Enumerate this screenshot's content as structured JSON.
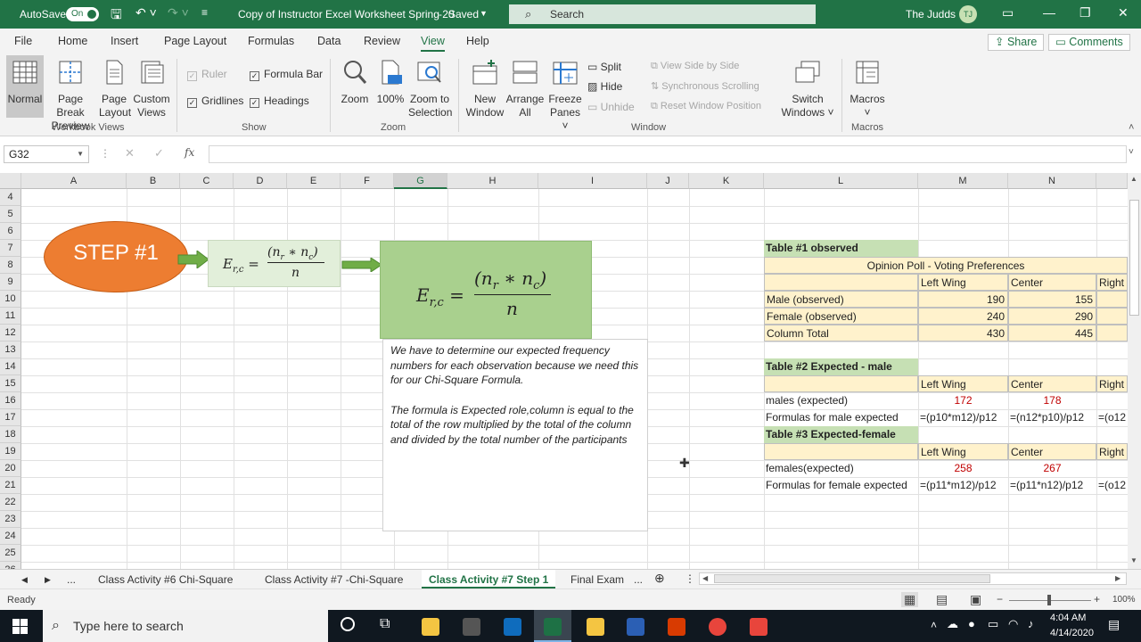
{
  "titlebar": {
    "autosave_label": "AutoSave",
    "autosave_state": "On",
    "file_title": "Copy of Instructor Excel Worksheet Spring 20",
    "save_status": "Saved",
    "search_placeholder": "Search",
    "user_name": "The Judds",
    "user_initials": "TJ"
  },
  "menu": {
    "items": [
      "File",
      "Home",
      "Insert",
      "Page Layout",
      "Formulas",
      "Data",
      "Review",
      "View",
      "Help"
    ],
    "active": "View",
    "share": "Share",
    "comments": "Comments"
  },
  "ribbon": {
    "workbook_views": {
      "normal": "Normal",
      "page_break_1": "Page Break",
      "page_break_2": "Preview",
      "page_layout_1": "Page",
      "page_layout_2": "Layout",
      "custom_1": "Custom",
      "custom_2": "Views",
      "group": "Workbook Views"
    },
    "show": {
      "ruler": "Ruler",
      "formula_bar": "Formula Bar",
      "gridlines": "Gridlines",
      "headings": "Headings",
      "group": "Show"
    },
    "zoom": {
      "zoom": "Zoom",
      "pct": "100%",
      "zoom_sel_1": "Zoom to",
      "zoom_sel_2": "Selection",
      "group": "Zoom"
    },
    "window": {
      "new_1": "New",
      "new_2": "Window",
      "arrange_1": "Arrange",
      "arrange_2": "All",
      "freeze_1": "Freeze",
      "freeze_2": "Panes",
      "split": "Split",
      "hide": "Hide",
      "unhide": "Unhide",
      "side_by_side": "View Side by Side",
      "sync_scroll": "Synchronous Scrolling",
      "reset_pos": "Reset Window Position",
      "switch_1": "Switch",
      "switch_2": "Windows",
      "group": "Window"
    },
    "macros": {
      "macros": "Macros",
      "group": "Macros"
    }
  },
  "formula_bar": {
    "name_box": "G32",
    "fx": "fx",
    "content": ""
  },
  "columns": [
    "A",
    "B",
    "C",
    "D",
    "E",
    "F",
    "G",
    "H",
    "I",
    "J",
    "K",
    "L",
    "M",
    "N"
  ],
  "selected_column": "G",
  "rows": [
    "4",
    "5",
    "6",
    "7",
    "8",
    "9",
    "10",
    "11",
    "12",
    "13",
    "14",
    "15",
    "16",
    "17",
    "18",
    "19",
    "20",
    "21",
    "22",
    "23",
    "24",
    "25",
    "26"
  ],
  "shapes": {
    "step_label": "STEP #1",
    "formula_lhs": "E",
    "formula_sub": "r,c",
    "formula_num": "(n",
    "formula_num_r": "r",
    "formula_num_mid": " ∗ n",
    "formula_num_c": "c",
    "formula_num_end": ")",
    "formula_den": "n",
    "note_p1": "We have to determine our expected frequency numbers for each observation because we need this for our Chi-Square Formula.",
    "note_p2": "The formula is Expected role,column is equal to the total of the row multiplied by the total of the column and divided by the total number of the participants"
  },
  "table1": {
    "title": "Table #1 observed",
    "header": "Opinion Poll - Voting Preferences",
    "cols": [
      "Left Wing",
      "Center",
      "Right"
    ],
    "rows": [
      {
        "label": "Male (observed)",
        "left": "190",
        "center": "155"
      },
      {
        "label": "Female (observed)",
        "left": "240",
        "center": "290"
      },
      {
        "label": "Column Total",
        "left": "430",
        "center": "445"
      }
    ]
  },
  "table2": {
    "title": "Table #2 Expected - male",
    "cols": [
      "Left Wing",
      "Center",
      "Right"
    ],
    "expected_label": "males (expected)",
    "expected_left": "172",
    "expected_center": "178",
    "formula_label": "Formulas for male expected",
    "formula_left": "=(p10*m12)/p12",
    "formula_center": "=(n12*p10)/p12",
    "formula_right": "=(o12"
  },
  "table3": {
    "title": "Table #3 Expected-female",
    "cols": [
      "Left Wing",
      "Center",
      "Right"
    ],
    "expected_label": "females(expected)",
    "expected_left": "258",
    "expected_center": "267",
    "formula_label": "Formulas for female expected",
    "formula_left": "=(p11*m12)/p12",
    "formula_center": "=(p11*n12)/p12",
    "formula_right": "=(o12"
  },
  "sheet_tabs": {
    "ellipsis": "...",
    "tabs": [
      "Class Activity #6 Chi-Square",
      "Class Activity #7 -Chi-Square",
      "Class Activity #7 Step 1",
      "Final Exam"
    ],
    "active": "Class Activity #7 Step 1"
  },
  "status": {
    "ready": "Ready",
    "zoom": "100%"
  },
  "taskbar": {
    "search_placeholder": "Type here to search",
    "time": "4:04 AM",
    "date": "4/14/2020"
  }
}
